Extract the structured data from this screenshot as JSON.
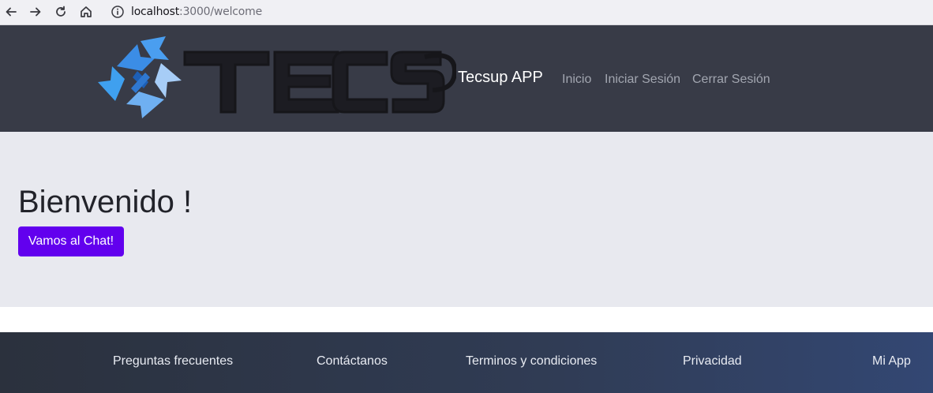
{
  "browser": {
    "url_host": "localhost",
    "url_rest": ":3000/welcome"
  },
  "header": {
    "logo_text": "TECSUP",
    "brand": "Tecsup APP",
    "nav": [
      "Inicio",
      "Iniciar Sesión",
      "Cerrar Sesión"
    ]
  },
  "hero": {
    "title": "Bienvenido !",
    "button_label": "Vamos al Chat!"
  },
  "footer": {
    "links": [
      "Preguntas frecuentes",
      "Contáctanos",
      "Terminos y condiciones",
      "Privacidad",
      "Mi App"
    ]
  },
  "colors": {
    "header_bg": "#383b47",
    "hero_bg": "#e8e9ef",
    "button_bg": "#6200ee",
    "footer_start": "#2b313d",
    "footer_end": "#334773"
  }
}
